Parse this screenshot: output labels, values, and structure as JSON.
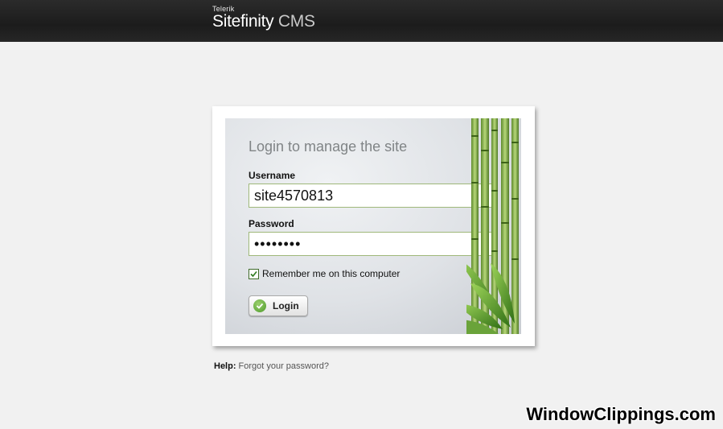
{
  "header": {
    "vendor": "Telerik",
    "product_main": "Sitefinity",
    "product_suffix": " CMS"
  },
  "login": {
    "title": "Login to manage the site",
    "username_label": "Username",
    "username_value": "site4570813",
    "password_label": "Password",
    "password_value": "••••••••",
    "remember_label": "Remember me on this computer",
    "remember_checked": true,
    "login_button_label": "Login"
  },
  "help": {
    "prefix": "Help:",
    "link_text": "Forgot your password?"
  },
  "watermark": "WindowClippings.com",
  "colors": {
    "header_bg": "#222222",
    "page_bg": "#f1f1f1",
    "field_border": "#9fb87a",
    "accent_green": "#4c9a2a"
  },
  "icons": {
    "checkbox": "checkmark-icon",
    "login": "check-circle-icon",
    "decoration": "bamboo-icon"
  }
}
